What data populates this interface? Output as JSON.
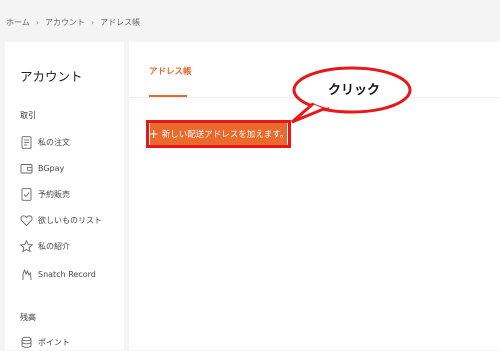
{
  "breadcrumb": {
    "items": [
      "ホーム",
      "アカウント",
      "アドレス帳"
    ],
    "separator": "›"
  },
  "sidebar": {
    "title": "アカウント",
    "sections": [
      {
        "label": "取引",
        "items": [
          {
            "label": "私の注文",
            "icon": "document-icon"
          },
          {
            "label": "BGpay",
            "icon": "wallet-icon"
          },
          {
            "label": "予約販売",
            "icon": "checklist-icon"
          },
          {
            "label": "欲しいものリスト",
            "icon": "heart-icon"
          },
          {
            "label": "私の紹介",
            "icon": "star-icon"
          },
          {
            "label": "Snatch Record",
            "icon": "hand-icon"
          }
        ]
      },
      {
        "label": "残高",
        "items": [
          {
            "label": "ポイント",
            "icon": "coin-stack-icon"
          }
        ]
      }
    ]
  },
  "main": {
    "tab_label": "アドレス帳",
    "add_button_label": "新しい配送アドレスを加えます。",
    "add_button_icon": "plus-icon"
  },
  "annotation": {
    "callout_text": "クリック",
    "highlight_color": "#e81818"
  },
  "colors": {
    "accent": "#e8672c",
    "button": "#ea6a2e",
    "background": "#f4f4f4"
  }
}
